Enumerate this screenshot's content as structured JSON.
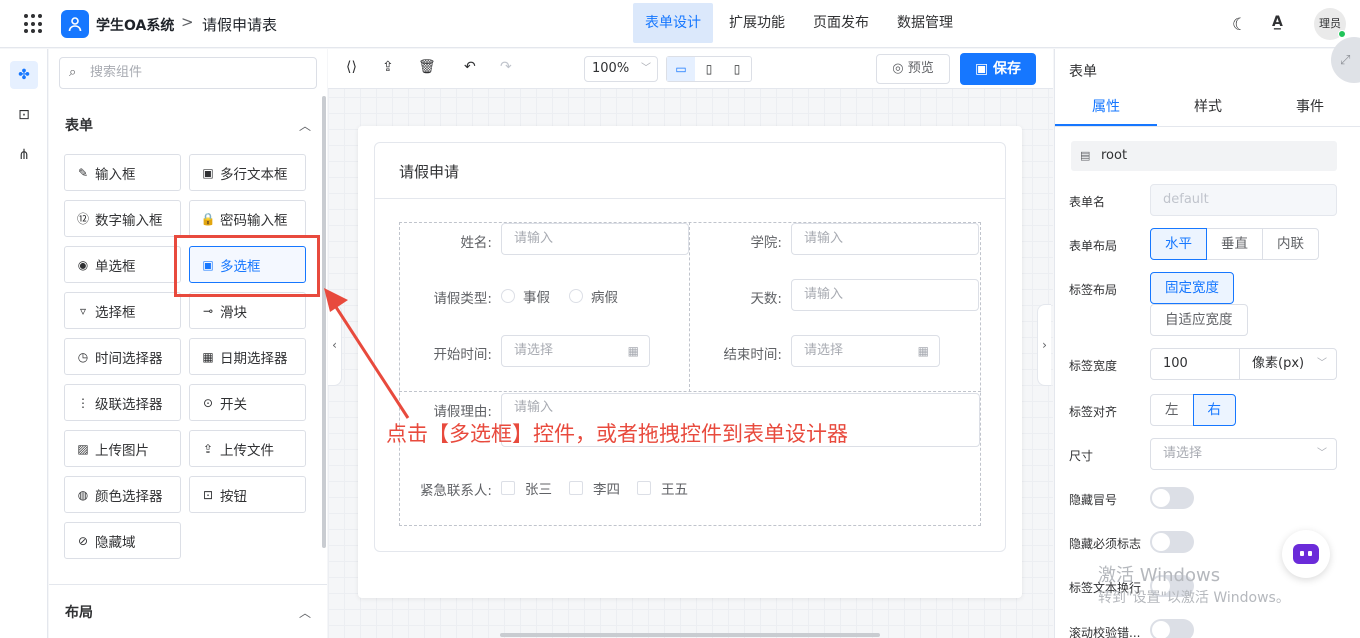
{
  "header": {
    "app_name": "学生OA系统",
    "separator": ">",
    "page_name": "请假申请表",
    "nav": [
      "表单设计",
      "扩展功能",
      "页面发布",
      "数据管理"
    ],
    "active_nav": "表单设计",
    "theme_icon": "moon-icon",
    "translate_icon": "translate-icon",
    "avatar_text": "理员"
  },
  "rail": {
    "items": [
      "puzzle-icon",
      "code-block-icon",
      "tree-icon"
    ]
  },
  "palette": {
    "search_placeholder": "搜索组件",
    "form_section": "表单",
    "layout_section": "布局",
    "components": [
      {
        "label": "输入框",
        "icon": "✎"
      },
      {
        "label": "多行文本框",
        "icon": "▣"
      },
      {
        "label": "数字输入框",
        "icon": "⑫"
      },
      {
        "label": "密码输入框",
        "icon": "🔒"
      },
      {
        "label": "单选框",
        "icon": "◉"
      },
      {
        "label": "多选框",
        "icon": "▣"
      },
      {
        "label": "选择框",
        "icon": "▿"
      },
      {
        "label": "滑块",
        "icon": "⊸"
      },
      {
        "label": "时间选择器",
        "icon": "◷"
      },
      {
        "label": "日期选择器",
        "icon": "▦"
      },
      {
        "label": "级联选择器",
        "icon": "⋮"
      },
      {
        "label": "开关",
        "icon": "⊙"
      },
      {
        "label": "上传图片",
        "icon": "▨"
      },
      {
        "label": "上传文件",
        "icon": "⇪"
      },
      {
        "label": "颜色选择器",
        "icon": "◍"
      },
      {
        "label": "按钮",
        "icon": "⊡"
      },
      {
        "label": "隐藏域",
        "icon": "⊘"
      }
    ]
  },
  "toolbar": {
    "zoom": "100%",
    "preview": "预览",
    "save": "保存"
  },
  "form": {
    "title": "请假申请",
    "name_label": "姓名:",
    "name_placeholder": "请输入",
    "college_label": "学院:",
    "college_placeholder": "请输入",
    "type_label": "请假类型:",
    "type_options": [
      "事假",
      "病假"
    ],
    "days_label": "天数:",
    "days_placeholder": "请输入",
    "start_label": "开始时间:",
    "start_placeholder": "请选择",
    "end_label": "结束时间:",
    "end_placeholder": "请选择",
    "reason_label": "请假理由:",
    "reason_placeholder": "请输入",
    "contact_label": "紧急联系人:",
    "contact_options": [
      "张三",
      "李四",
      "王五"
    ]
  },
  "annotation": "点击【多选框】控件，或者拖拽控件到表单设计器",
  "props": {
    "title": "表单",
    "tabs": [
      "属性",
      "样式",
      "事件"
    ],
    "root": "root",
    "form_name_label": "表单名",
    "form_name_value": "default",
    "form_layout_label": "表单布局",
    "form_layout_options": [
      "水平",
      "垂直",
      "内联"
    ],
    "label_layout_label": "标签布局",
    "label_layout_options": [
      "固定宽度",
      "自适应宽度"
    ],
    "label_width_label": "标签宽度",
    "label_width_value": "100",
    "label_width_unit": "像素(px)",
    "label_align_label": "标签对齐",
    "label_align_options": [
      "左",
      "右"
    ],
    "size_label": "尺寸",
    "size_placeholder": "请选择",
    "hide_colon_label": "隐藏冒号",
    "hide_required_label": "隐藏必须标志",
    "label_wrap_label": "标签文本换行",
    "scroll_label": "滚动校验错..."
  },
  "watermark": {
    "line1": "激活 Windows",
    "line2": "转到\"设置\"以激活 Windows。"
  },
  "colors": {
    "primary": "#1677ff",
    "annotation": "#e84a3d"
  }
}
